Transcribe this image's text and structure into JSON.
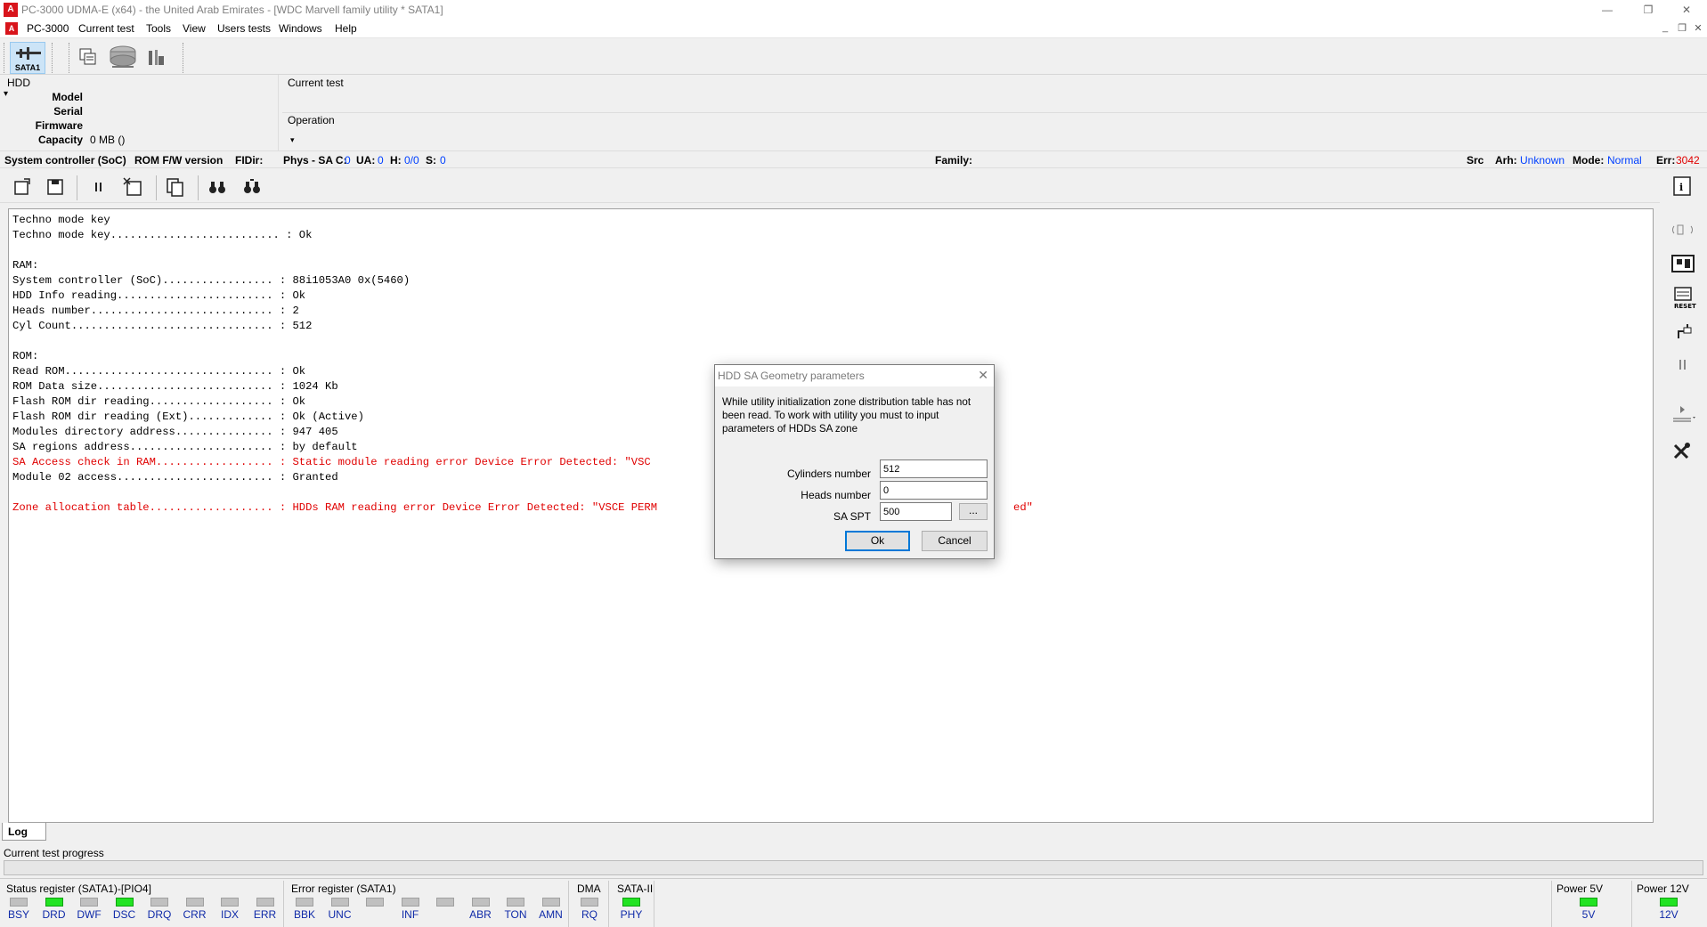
{
  "window": {
    "title": "PC-3000 UDMA-E (x64) - the United Arab Emirates - [WDC Marvell family utility * SATA1]",
    "app_icon_text": "A",
    "controls": {
      "minimize": "—",
      "maximize": "❐",
      "close": "✕"
    }
  },
  "menu": {
    "items": [
      "PC-3000",
      "Current test",
      "Tools",
      "View",
      "Users tests",
      "Windows",
      "Help"
    ],
    "mdi": {
      "minimize": "_",
      "restore": "❐",
      "close": "✕"
    }
  },
  "toolbar": {
    "sata_label": "SATA1"
  },
  "hdd": {
    "title": "HDD",
    "collapse": "▾",
    "labels": [
      "Model",
      "Serial",
      "Firmware",
      "Capacity"
    ],
    "capacity": "0 MB ()"
  },
  "current_test": {
    "title": "Current test"
  },
  "operation": {
    "title": "Operation",
    "dropdown": "▾"
  },
  "statusline": {
    "soc": "System controller (SoC)",
    "rom": "ROM F/W version",
    "fidir": "FIDir:",
    "phys_label": "Phys - SA C:",
    "phys_c": "0",
    "ua_label": "UA:",
    "ua": "0",
    "h_label": "H:",
    "h": "0/0",
    "s_label": "S:",
    "s": "0",
    "family": "Family:",
    "src": "Src",
    "arh_label": "Arh:",
    "arh": "Unknown",
    "mode_label": "Mode:",
    "mode": "Normal",
    "err_label": "Err:",
    "err": "3042"
  },
  "log": {
    "lines": [
      {
        "text": "Techno mode key",
        "color": "#000000"
      },
      {
        "text": "Techno mode key.......................... : Ok",
        "color": "#000000"
      },
      {
        "text": "",
        "color": "#000000"
      },
      {
        "text": "RAM:",
        "color": "#000000"
      },
      {
        "text": "System controller (SoC)................. : 88i1053A0 0x(5460)",
        "color": "#000000"
      },
      {
        "text": "HDD Info reading........................ : Ok",
        "color": "#000000"
      },
      {
        "text": "Heads number............................ : 2",
        "color": "#000000"
      },
      {
        "text": "Cyl Count............................... : 512",
        "color": "#000000"
      },
      {
        "text": "",
        "color": "#000000"
      },
      {
        "text": "ROM:",
        "color": "#000000"
      },
      {
        "text": "Read ROM................................ : Ok",
        "color": "#000000"
      },
      {
        "text": "ROM Data size........................... : 1024 Kb",
        "color": "#000000"
      },
      {
        "text": "Flash ROM dir reading................... : Ok",
        "color": "#000000"
      },
      {
        "text": "Flash ROM dir reading (Ext)............. : Ok (Active)",
        "color": "#000000"
      },
      {
        "text": "Modules directory address............... : 947 405",
        "color": "#000000"
      },
      {
        "text": "SA regions address...................... : by default",
        "color": "#000000"
      },
      {
        "text": "SA Access check in RAM.................. : Static module reading error Device Error Detected: \"VSC",
        "color": "#e00000"
      },
      {
        "text": "Module 02 access........................ : Granted",
        "color": "#000000"
      },
      {
        "text": "",
        "color": "#000000"
      },
      {
        "text": "Zone allocation table................... : HDDs RAM reading error Device Error Detected: \"VSCE PERM",
        "color": "#e00000"
      }
    ],
    "overflow_fragment": "ed\"",
    "tab_label": "Log"
  },
  "progress": {
    "label": "Current test progress"
  },
  "status_register": {
    "title": "Status register (SATA1)-[PIO4]",
    "leds": [
      {
        "label": "BSY",
        "on": false
      },
      {
        "label": "DRD",
        "on": true
      },
      {
        "label": "DWF",
        "on": false
      },
      {
        "label": "DSC",
        "on": true
      },
      {
        "label": "DRQ",
        "on": false
      },
      {
        "label": "CRR",
        "on": false
      },
      {
        "label": "IDX",
        "on": false
      },
      {
        "label": "ERR",
        "on": false
      }
    ]
  },
  "error_register": {
    "title": "Error register (SATA1)",
    "leds": [
      {
        "label": "BBK",
        "on": false
      },
      {
        "label": "UNC",
        "on": false
      },
      {
        "label": "",
        "on": false
      },
      {
        "label": "INF",
        "on": false
      },
      {
        "label": "",
        "on": false
      },
      {
        "label": "ABR",
        "on": false
      },
      {
        "label": "TON",
        "on": false
      },
      {
        "label": "AMN",
        "on": false
      }
    ]
  },
  "dma": {
    "title": "DMA",
    "led": {
      "label": "RQ",
      "on": false
    }
  },
  "sata2": {
    "title": "SATA-II",
    "led": {
      "label": "PHY",
      "on": true
    }
  },
  "power5": {
    "title": "Power 5V",
    "led": {
      "label": "5V",
      "on": true
    }
  },
  "power12": {
    "title": "Power 12V",
    "led": {
      "label": "12V",
      "on": true
    }
  },
  "dialog": {
    "title": "HDD SA Geometry parameters",
    "close": "✕",
    "message": "While utility initialization zone distribution table has not been read. To work with utility you must to input parameters of HDDs SA zone",
    "cylinders_label": "Cylinders number",
    "cylinders_value": "512",
    "heads_label": "Heads number",
    "heads_value": "0",
    "spt_label": "SA SPT",
    "spt_value": "500",
    "browse_label": "...",
    "ok_label": "Ok",
    "cancel_label": "Cancel"
  },
  "colors": {
    "accent": "#0078d7",
    "error_text": "#e00000",
    "led_on": "#22e322",
    "led_off": "#c0c0c0",
    "value_blue": "#0040ff",
    "title_red": "#d8141b"
  }
}
